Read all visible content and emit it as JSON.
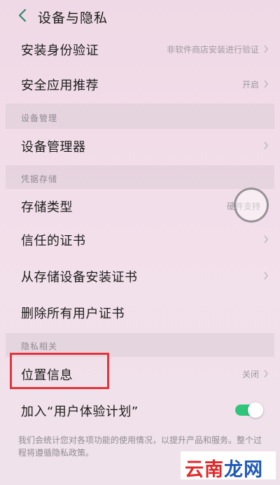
{
  "header": {
    "title": "设备与隐私"
  },
  "rows": {
    "install_verification": {
      "label": "安装身份验证",
      "value": "非软件商店安装进行验证"
    },
    "safe_app_recommend": {
      "label": "安全应用推荐",
      "value": "开启"
    },
    "device_manager": {
      "label": "设备管理器"
    },
    "storage_type": {
      "label": "存储类型",
      "value": "硬件支持"
    },
    "trusted_certs": {
      "label": "信任的证书"
    },
    "install_from_storage": {
      "label": "从存储设备安装证书"
    },
    "delete_user_certs": {
      "label": "删除所有用户证书"
    },
    "location_info": {
      "label": "位置信息",
      "value": "关闭"
    },
    "user_experience": {
      "label": "加入“用户体验计划”",
      "toggle_on": true
    }
  },
  "sections": {
    "device_management": "设备管理",
    "credential_storage": "凭据存储",
    "privacy": "隐私相关"
  },
  "description": "我们会统计您对各项功能的使用情况，以提升产品和服务。整个过程将遵循隐私政策。",
  "watermark": {
    "part1": "云南",
    "part2": "龙网"
  },
  "colors": {
    "toggle_on": "#2fc57a",
    "highlight": "#e4343b"
  }
}
